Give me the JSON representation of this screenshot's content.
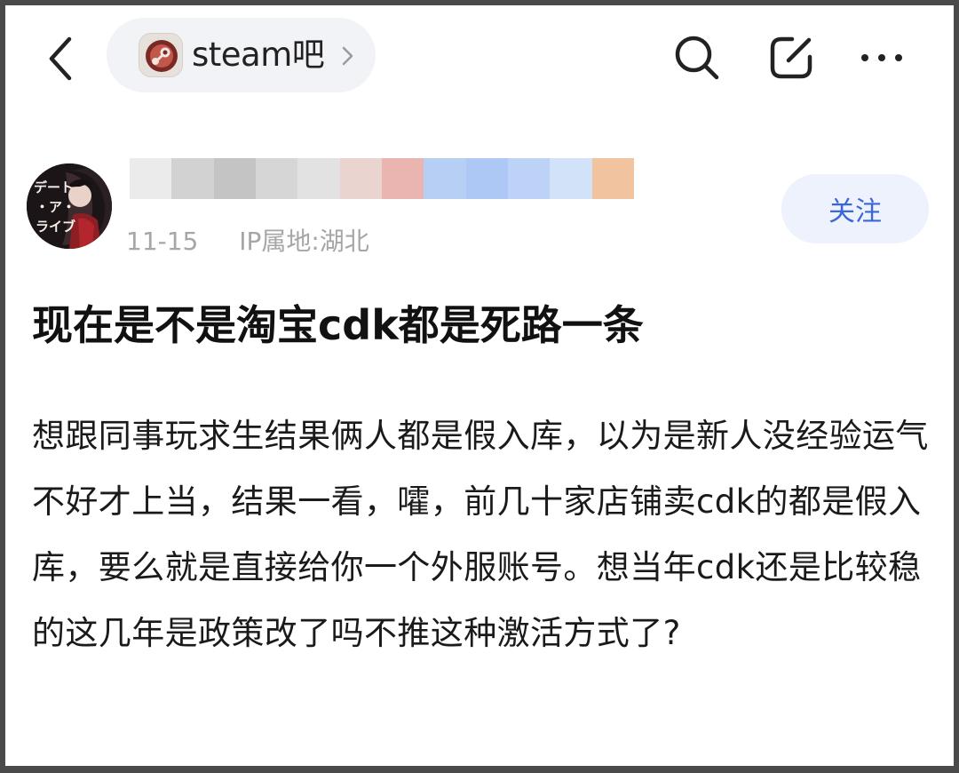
{
  "header": {
    "forum_name": "steam吧",
    "icons": {
      "back": "chevron-left-icon",
      "forum_chevron": "chevron-right-icon",
      "search": "search-icon",
      "edit": "edit-icon",
      "more": "more-icon"
    }
  },
  "author": {
    "date": "11-15",
    "ip_location": "IP属地:湖北",
    "follow_label": "关注"
  },
  "post": {
    "title": "现在是不是淘宝cdk都是死路一条",
    "body": "想跟同事玩求生结果俩人都是假入库，以为是新人没经验运气不好才上当，结果一看，嚯，前几十家店铺卖cdk的都是假入库，要么就是直接给你一个外服账号。想当年cdk还是比较稳的这几年是政策改了吗不推这种激活方式了?"
  },
  "colors": {
    "accent": "#3a66d8",
    "follow_bg": "#eef2fd",
    "pill_bg": "#f2f3f7",
    "meta_text": "#a6a6a6"
  }
}
